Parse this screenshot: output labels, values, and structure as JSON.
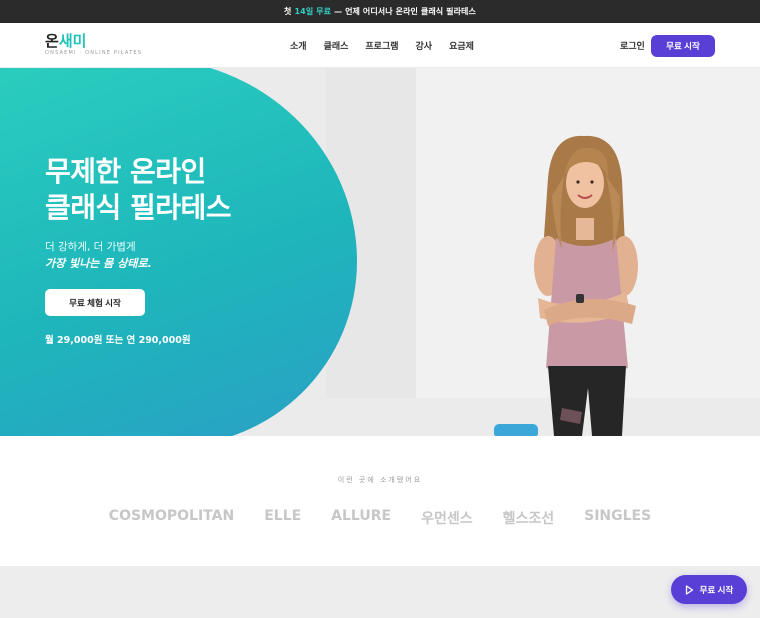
{
  "topbar": {
    "pre": "첫",
    "highlight": "14일 무료",
    "post": "— 언제 어디서나 온라인 클래식 필라테스"
  },
  "header": {
    "logo_main_a": "온",
    "logo_main_b": "새미",
    "logo_sub": "ONSAEMI · ONLINE PILATES",
    "nav": [
      "소개",
      "클래스",
      "프로그램",
      "강사",
      "요금제"
    ],
    "login": "로그인",
    "cta": "무료 시작"
  },
  "hero": {
    "title_line1": "무제한 온라인",
    "title_line2": "클래식 필라테스",
    "sub1": "더 강하게, 더 가볍게",
    "sub2": "가장 빛나는 몸 상태로.",
    "cta": "무료 체험 시작",
    "price": "월 29,000원 또는 연 290,000원"
  },
  "press": {
    "label": "이런 곳에 소개됐어요",
    "logos": [
      "COSMOPOLITAN",
      "ELLE",
      "ALLURE",
      "우먼센스",
      "헬스조선",
      "SINGLES"
    ]
  },
  "float_cta": {
    "label": "무료 시작",
    "icon": "play-icon"
  },
  "colors": {
    "accent_teal": "#1fc3b6",
    "brand_purple": "#5a3fd6",
    "topbar": "#2b2b2b"
  }
}
